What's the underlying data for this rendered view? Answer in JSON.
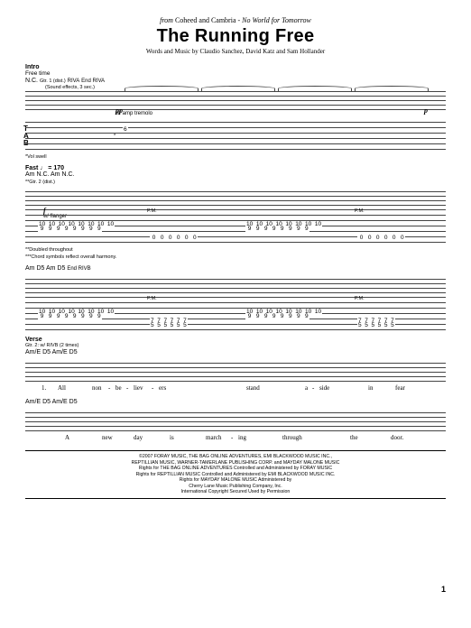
{
  "header": {
    "source_prefix": "from",
    "artist": "Coheed and Cambria",
    "separator": "-",
    "album": "No World for Tomorrow",
    "title": "The Running Free",
    "credits": "Words and Music by Claudio Sanchez, David Katz and Sam Hollander"
  },
  "sections": {
    "intro": {
      "label": "Intro",
      "tempo_note": "Free time",
      "chord": "N.C."
    },
    "fast": {
      "label": "Fast",
      "tempo": "♩ = 170"
    },
    "verse": {
      "label": "Verse"
    }
  },
  "sys1": {
    "gtr_label": "Gtr. 1 (dist.)",
    "fx": "(Sound effects, 3 sec.)",
    "dyn_start": "pp",
    "dyn_end": "p",
    "perf": "w/ amp tremolo",
    "marker_left": "RIVA",
    "marker_right": "End RIVA",
    "tab_val": "6",
    "note_vol": "*Vol swell"
  },
  "sys2": {
    "gtr_label": "**Gtr. 2 (dist.)",
    "dyn": "f",
    "perf": "w/ flanger",
    "chords": [
      "Am",
      "N.C.",
      "Am",
      "N.C."
    ],
    "pm": "P.M.",
    "tab_pair_top": "10  10  10  10  10  10  10  10",
    "tab_pair_bot": " 9   9   9   9   9   9   9   9",
    "tab_low": " 0   0   0   0   0   0",
    "fn1": "**Doubled throughout",
    "fn2": "***Chord symbols reflect overall harmony."
  },
  "sys3": {
    "chords": [
      "Am",
      "D5",
      "Am",
      "D5"
    ],
    "marker_right": "End RIVB",
    "pm": "P.M.",
    "tab_pair_top": "10  10  10  10  10  10  10  10",
    "tab_pair_bot": " 9   9   9   9   9   9   9   9",
    "tab_d5_top": "7  7  7  7  7  7",
    "tab_d5_bot": "5  5  5  5  5  5"
  },
  "sys4": {
    "riff_note": "Gtr. 2: w/ RIVB (2 times)",
    "chords": [
      "Am/E",
      "D5",
      "Am/E",
      "D5"
    ],
    "lyric_num": "1.",
    "lyrics": [
      "All",
      "non",
      "-",
      "be",
      "-",
      "liev",
      "-",
      "ers",
      "stand",
      "a",
      "-",
      "side",
      "in",
      "fear"
    ]
  },
  "sys5": {
    "chords": [
      "Am/E",
      "D5",
      "Am/E",
      "D5"
    ],
    "lyrics": [
      "A",
      "new",
      "day",
      "is",
      "march",
      "-",
      "ing",
      "through",
      "the",
      "door."
    ]
  },
  "copyright": {
    "l1": "©2007 FORAY MUSIC, THE BAG ONLINE ADVENTURES, EMI BLACKWOOD MUSIC INC.,",
    "l2": "REPTILLIAN MUSIC, WARNER-TAMERLANE PUBLISHING CORP. and MAYDAY MALONE MUSIC",
    "l3": "Rights for THE BAG ONLINE ADVENTURES Controlled and Administered by FORAY MUSIC",
    "l4": "Rights for REPTILLIAN MUSIC Controlled and Administered by EMI BLACKWOOD MUSIC INC.",
    "l5": "Rights for MAYDAY MALONE MUSIC Administered by",
    "l6": "Cherry Lane Music Publishing Company, Inc.",
    "l7": "International Copyright Secured   Used by Permission"
  },
  "page_number": "1"
}
